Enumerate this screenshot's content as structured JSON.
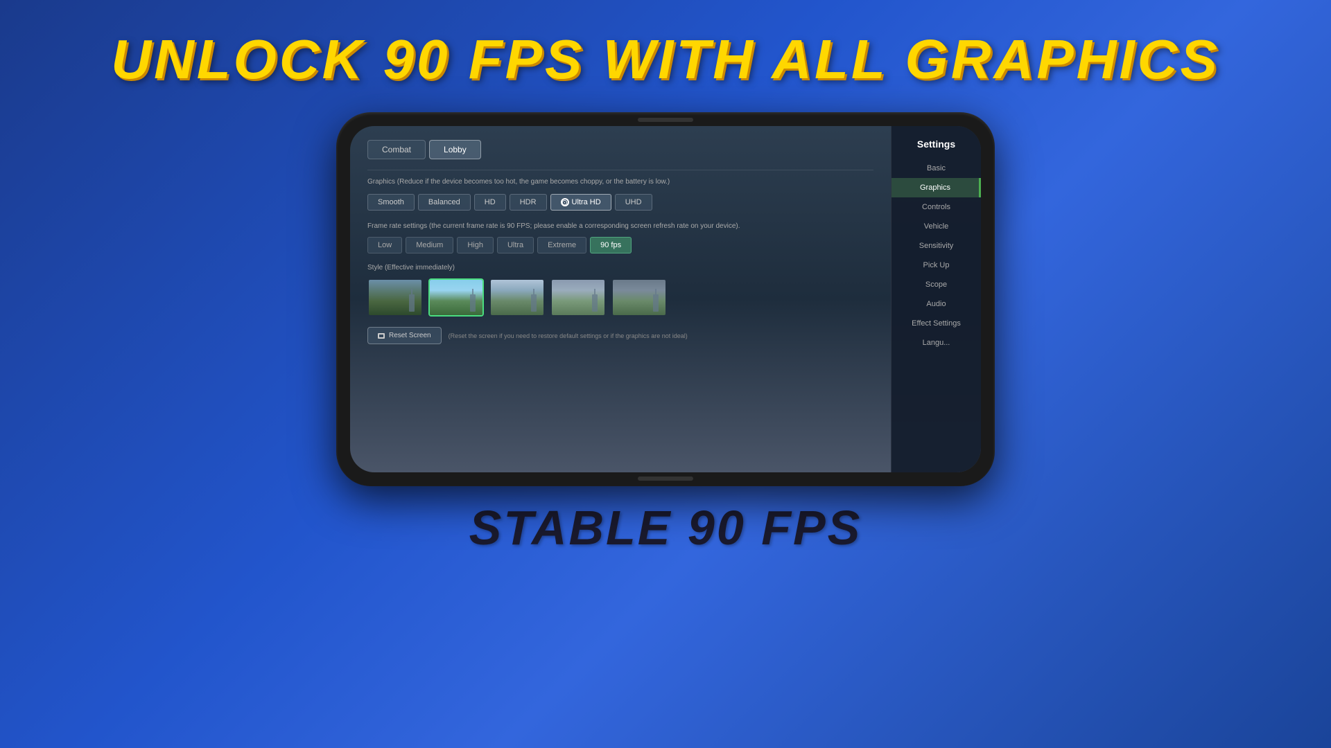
{
  "page": {
    "title_top": "UNLOCK 90 FPS WITH ALL GRAPHICS",
    "title_bottom": "STABLE 90 FPS"
  },
  "settings": {
    "title": "Settings",
    "sidebar": {
      "items": [
        {
          "id": "basic",
          "label": "Basic",
          "active": false
        },
        {
          "id": "graphics",
          "label": "Graphics",
          "active": true
        },
        {
          "id": "controls",
          "label": "Controls",
          "active": false
        },
        {
          "id": "vehicle",
          "label": "Vehicle",
          "active": false
        },
        {
          "id": "sensitivity",
          "label": "Sensitivity",
          "active": false
        },
        {
          "id": "pickup",
          "label": "Pick Up",
          "active": false
        },
        {
          "id": "scope",
          "label": "Scope",
          "active": false
        },
        {
          "id": "audio",
          "label": "Audio",
          "active": false
        },
        {
          "id": "effect",
          "label": "Effect Settings",
          "active": false
        },
        {
          "id": "lang",
          "label": "Langu...",
          "active": false
        }
      ]
    }
  },
  "tabs": [
    {
      "id": "combat",
      "label": "Combat",
      "active": false
    },
    {
      "id": "lobby",
      "label": "Lobby",
      "active": true
    }
  ],
  "graphics_section": {
    "label": "Graphics (Reduce if the device becomes too hot, the game becomes choppy, or the battery is low.)",
    "quality_options": [
      {
        "id": "smooth",
        "label": "Smooth",
        "active": false
      },
      {
        "id": "balanced",
        "label": "Balanced",
        "active": false
      },
      {
        "id": "hd",
        "label": "HD",
        "active": false
      },
      {
        "id": "hdr",
        "label": "HDR",
        "active": false
      },
      {
        "id": "ultra_hd",
        "label": "Ultra HD",
        "active": true,
        "has_icon": true
      },
      {
        "id": "uhd",
        "label": "UHD",
        "active": false
      }
    ]
  },
  "framerate_section": {
    "label": "Frame rate settings (the current frame rate is 90 FPS; please enable a corresponding screen refresh rate on your device).",
    "fps_options": [
      {
        "id": "low",
        "label": "Low",
        "active": false
      },
      {
        "id": "medium",
        "label": "Medium",
        "active": false
      },
      {
        "id": "high",
        "label": "High",
        "active": false
      },
      {
        "id": "ultra",
        "label": "Ultra",
        "active": false
      },
      {
        "id": "extreme",
        "label": "Extreme",
        "active": false
      },
      {
        "id": "90fps",
        "label": "90 fps",
        "active": true
      }
    ]
  },
  "style_section": {
    "label": "Style (Effective immediately)",
    "thumbnails": [
      {
        "id": "style1",
        "selected": false
      },
      {
        "id": "style2",
        "selected": true
      },
      {
        "id": "style3",
        "selected": false
      },
      {
        "id": "style4",
        "selected": false
      },
      {
        "id": "style5",
        "selected": false
      }
    ]
  },
  "reset": {
    "button_label": "Reset Screen",
    "description": "(Reset the screen if you need to restore default settings or if the graphics are not ideal)"
  }
}
